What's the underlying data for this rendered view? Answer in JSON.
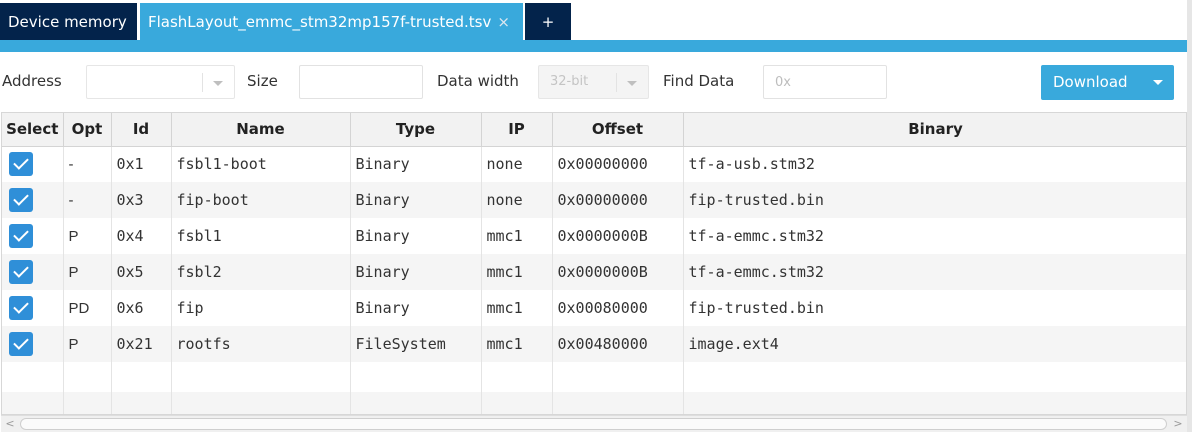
{
  "tabs": [
    {
      "label": "Device memory"
    },
    {
      "label": "FlashLayout_emmc_stm32mp157f-trusted.tsv",
      "close": "×"
    },
    {
      "label": "+"
    }
  ],
  "toolbar": {
    "address_label": "Address",
    "address_value": "",
    "size_label": "Size",
    "size_value": "",
    "datawidth_label": "Data width",
    "datawidth_value": "32-bit",
    "find_label": "Find Data",
    "find_placeholder": "0x",
    "download_label": "Download"
  },
  "table": {
    "columns": [
      "Select",
      "Opt",
      "Id",
      "Name",
      "Type",
      "IP",
      "Offset",
      "Binary"
    ],
    "rows": [
      {
        "checked": true,
        "opt": "-",
        "id": "0x1",
        "name": "fsbl1-boot",
        "type": "Binary",
        "ip": "none",
        "offset": "0x00000000",
        "binary": "tf-a-usb.stm32"
      },
      {
        "checked": true,
        "opt": "-",
        "id": "0x3",
        "name": "fip-boot",
        "type": "Binary",
        "ip": "none",
        "offset": "0x00000000",
        "binary": "fip-trusted.bin"
      },
      {
        "checked": true,
        "opt": "P",
        "id": "0x4",
        "name": "fsbl1",
        "type": "Binary",
        "ip": "mmc1",
        "offset": "0x0000000B",
        "binary": "tf-a-emmc.stm32"
      },
      {
        "checked": true,
        "opt": "P",
        "id": "0x5",
        "name": "fsbl2",
        "type": "Binary",
        "ip": "mmc1",
        "offset": "0x0000000B",
        "binary": "tf-a-emmc.stm32"
      },
      {
        "checked": true,
        "opt": "PD",
        "id": "0x6",
        "name": "fip",
        "type": "Binary",
        "ip": "mmc1",
        "offset": "0x00080000",
        "binary": "fip-trusted.bin"
      },
      {
        "checked": true,
        "opt": "P",
        "id": "0x21",
        "name": "rootfs",
        "type": "FileSystem",
        "ip": "mmc1",
        "offset": "0x00480000",
        "binary": "image.ext4"
      }
    ]
  },
  "scrollbar": {
    "left_arrow": "<",
    "right_arrow": ">"
  },
  "colors": {
    "accent": "#39a9dc",
    "dark_tab": "#03234b",
    "checkbox": "#2f8fd8"
  }
}
